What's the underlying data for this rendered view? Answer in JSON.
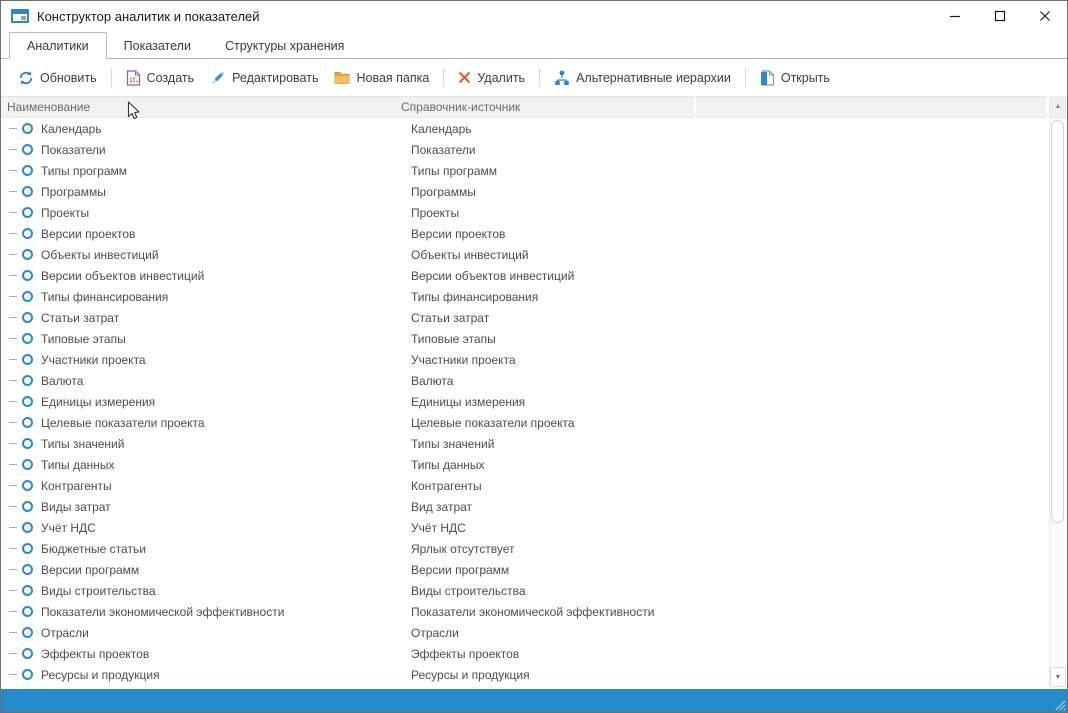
{
  "window": {
    "title": "Конструктор аналитик и показателей"
  },
  "tabs": [
    {
      "label": "Аналитики",
      "active": true
    },
    {
      "label": "Показатели",
      "active": false
    },
    {
      "label": "Структуры хранения",
      "active": false
    }
  ],
  "toolbar": {
    "buttons": [
      {
        "label": "Обновить",
        "icon": "refresh-icon"
      },
      {
        "label": "Создать",
        "icon": "create-document-icon"
      },
      {
        "label": "Редактировать",
        "icon": "edit-pencil-icon"
      },
      {
        "label": "Новая папка",
        "icon": "new-folder-icon"
      },
      {
        "label": "Удалить",
        "icon": "delete-x-icon"
      },
      {
        "label": "Альтернативные иерархии",
        "icon": "alt-hierarchies-icon"
      },
      {
        "label": "Открыть",
        "icon": "open-document-icon"
      }
    ]
  },
  "table": {
    "columns": [
      {
        "label": "Наименование"
      },
      {
        "label": "Справочник-источник"
      }
    ],
    "rows": [
      {
        "name": "Календарь",
        "source": "Календарь"
      },
      {
        "name": "Показатели",
        "source": "Показатели"
      },
      {
        "name": "Типы программ",
        "source": "Типы программ"
      },
      {
        "name": "Программы",
        "source": "Программы"
      },
      {
        "name": "Проекты",
        "source": "Проекты"
      },
      {
        "name": "Версии проектов",
        "source": "Версии проектов"
      },
      {
        "name": "Объекты инвестиций",
        "source": "Объекты инвестиций"
      },
      {
        "name": "Версии объектов инвестиций",
        "source": "Версии объектов инвестиций"
      },
      {
        "name": "Типы финансирования",
        "source": "Типы финансирования"
      },
      {
        "name": "Статьи затрат",
        "source": "Статьи затрат"
      },
      {
        "name": "Типовые этапы",
        "source": "Типовые этапы"
      },
      {
        "name": "Участники проекта",
        "source": "Участники проекта"
      },
      {
        "name": "Валюта",
        "source": "Валюта"
      },
      {
        "name": "Единицы измерения",
        "source": "Единицы измерения"
      },
      {
        "name": "Целевые показатели проекта",
        "source": "Целевые показатели проекта"
      },
      {
        "name": "Типы значений",
        "source": "Типы значений"
      },
      {
        "name": "Типы данных",
        "source": "Типы данных"
      },
      {
        "name": "Контрагенты",
        "source": "Контрагенты"
      },
      {
        "name": "Виды затрат",
        "source": "Вид затрат"
      },
      {
        "name": "Учёт НДС",
        "source": "Учёт НДС"
      },
      {
        "name": "Бюджетные статьи",
        "source": "Ярлык отсутствует"
      },
      {
        "name": "Версии программ",
        "source": "Версии программ"
      },
      {
        "name": "Виды строительства",
        "source": "Виды строительства"
      },
      {
        "name": "Показатели экономической эффективности",
        "source": "Показатели экономической эффективности"
      },
      {
        "name": "Отрасли",
        "source": "Отрасли"
      },
      {
        "name": "Эффекты проектов",
        "source": "Эффекты проектов"
      },
      {
        "name": "Ресурсы и продукция",
        "source": "Ресурсы и продукция"
      }
    ]
  },
  "scrollbar": {
    "up_glyph": "▲",
    "down_glyph": "▼"
  },
  "colors": {
    "accent_blue": "#2a8ad0",
    "status_bar_blue": "#268bca",
    "header_bg": "#f2f2f1",
    "folder_orange": "#eda63a",
    "delete_red": "#e2573d",
    "create_purple": "#a05aa5"
  }
}
